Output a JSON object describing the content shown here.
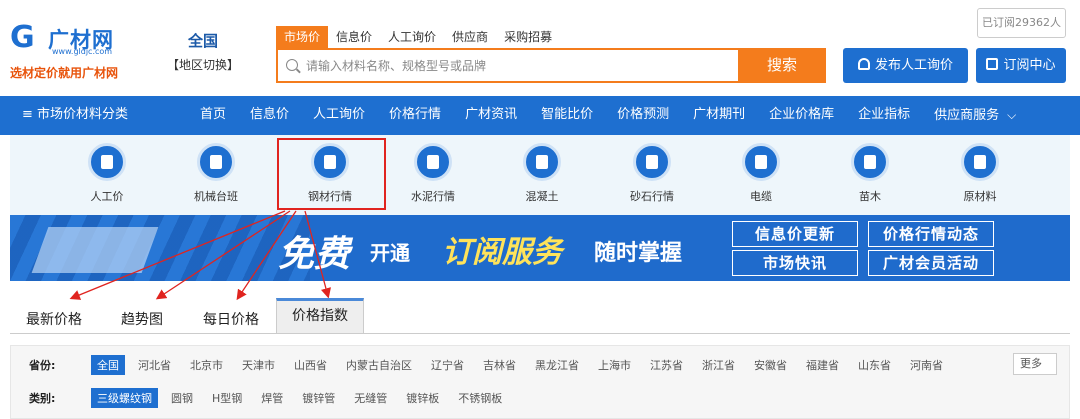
{
  "logo": {
    "mark": "G",
    "name": "广材网",
    "url": "www.gldjc.com",
    "slogan": "选材定价就用广材网"
  },
  "region": {
    "name": "全国",
    "switch_label": "【地区切换】"
  },
  "search": {
    "tabs": [
      "市场价",
      "信息价",
      "人工询价",
      "供应商",
      "采购招募"
    ],
    "placeholder": "请输入材料名称、规格型号或品牌",
    "button_label": "搜索"
  },
  "header": {
    "subscribed": "已订阅29362人",
    "publish_label": "发布人工询价",
    "subscribe_center_label": "订阅中心"
  },
  "nav": {
    "category_label": "≡ 市场价材料分类",
    "items": [
      "首页",
      "信息价",
      "人工询价",
      "价格行情",
      "广材资讯",
      "智能比价",
      "价格预测",
      "广材期刊",
      "企业价格库",
      "企业指标",
      "供应商服务"
    ]
  },
  "categories": [
    {
      "label": "人工价",
      "icon": "worker-icon"
    },
    {
      "label": "机械台班",
      "icon": "excavator-icon"
    },
    {
      "label": "钢材行情",
      "icon": "steel-icon"
    },
    {
      "label": "水泥行情",
      "icon": "cement-icon"
    },
    {
      "label": "混凝土",
      "icon": "mixer-truck-icon"
    },
    {
      "label": "砂石行情",
      "icon": "wheelbarrow-icon"
    },
    {
      "label": "电缆",
      "icon": "cable-reel-icon"
    },
    {
      "label": "苗木",
      "icon": "tree-icon"
    },
    {
      "label": "原材料",
      "icon": "barrel-icon"
    }
  ],
  "banner": {
    "free": "免费",
    "open": "开通",
    "service": "订阅服务",
    "always": "随时掌握",
    "tags": [
      "信息价更新",
      "价格行情动态",
      "市场快讯",
      "广材会员活动"
    ]
  },
  "view_tabs": [
    "最新价格",
    "趋势图",
    "每日价格",
    "价格指数"
  ],
  "active_view_tab": "价格指数",
  "filters": {
    "province_label": "省份:",
    "provinces": [
      "全国",
      "河北省",
      "北京市",
      "天津市",
      "山西省",
      "内蒙古自治区",
      "辽宁省",
      "吉林省",
      "黑龙江省",
      "上海市",
      "江苏省",
      "浙江省",
      "安徽省",
      "福建省",
      "山东省",
      "河南省"
    ],
    "more_label": "更多",
    "category_label": "类别:",
    "categories": [
      "三级螺纹钢",
      "圆钢",
      "H型钢",
      "焊管",
      "镀锌管",
      "无缝管",
      "镀锌板",
      "不锈钢板"
    ]
  },
  "colors": {
    "brand_blue": "#1e6fd0",
    "accent_orange": "#f47c1c",
    "annotation_red": "#e0241f"
  }
}
